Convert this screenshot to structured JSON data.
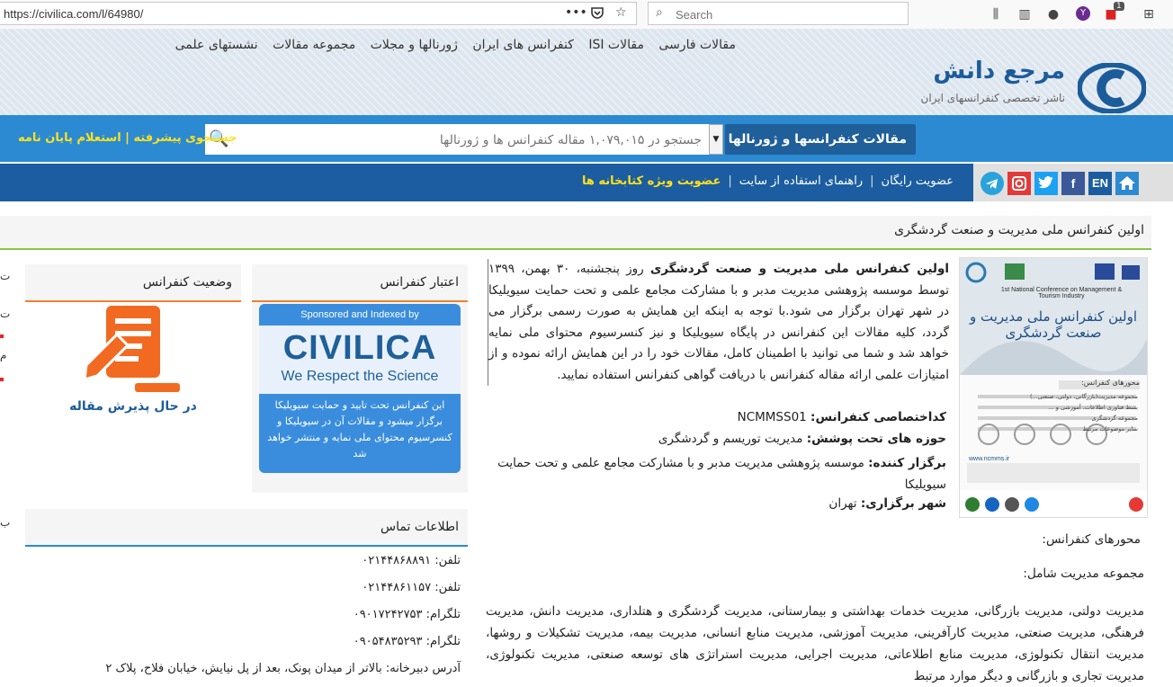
{
  "browser": {
    "url": "https://civilica.com/l/64980/",
    "search_placeholder": "Search",
    "badge_count": "1"
  },
  "header": {
    "nav": [
      "مقالات فارسی",
      "مقالات ISI",
      "کنفرانس های ایران",
      "ژورنالها و مجلات",
      "مجموعه مقالات",
      "نشستهای علمی"
    ],
    "brand_title": "مرجع دانش",
    "brand_subtitle": "ناشر تخصصی کنفرانسهای ایران"
  },
  "search": {
    "category": "مقالات کنفرانسها و ژورنالها داخلی",
    "placeholder": "جستجو در ۱,۰۷۹,۰۱۵ مقاله کنفرانس ها و ژورنالها",
    "links": "جستجوی پیشرفته | استعلام پایان نامه"
  },
  "navbar": {
    "lang": "EN",
    "links": [
      "عضویت رایگان",
      "راهنمای استفاده از سایت",
      "عضویت ویژه کتابخانه ها"
    ]
  },
  "conference": {
    "title": "اولین کنفرانس ملی مدیریت و صنعت گردشگری",
    "desc_strong": "اولین کنفرانس ملی مدیریت و صنعت گردشگری",
    "desc_rest": " روز پنجشنبه، ۳۰ بهمن، ۱۳۹۹ توسط موسسه پژوهشی مدیریت مدبر و با مشارکت مجامع علمی و تحت حمایت سیویلیکا در شهر تهران برگزار می شود.با توجه به اینکه این همایش به صورت رسمی برگزار می گردد، کلیه مقالات این کنفرانس در پایگاه سیویلیکا و نیز کنسرسیوم محتوای ملی نمایه خواهد شد و شما می توانید با اطمینان کامل، مقالات خود را در این همایش ارائه نموده و از امتیازات علمی ارائه مقاله کنفرانس با دریافت گواهی کنفرانس استفاده نمایید.",
    "code_label": "کداختصاصی کنفرانس:",
    "code": "NCMMSS01",
    "domain_label": "حوزه های تحت پوشش:",
    "domain": "مدیریت توریسم و گردشگری",
    "organizer_label": "برگزار کننده:",
    "organizer": "موسسه پژوهشی مدیریت مدبر و با مشارکت مجامع علمی و تحت حمایت سیویلیکا",
    "city_label": "شهر برگزاری:",
    "city": "تهران",
    "axes_heading": "محورهای کنفرانس:",
    "axes_group": "مجموعه مدیریت شامل:",
    "axes_text": "مدیریت دولتی، مدیریت بازرگانی، مدیریت خدمات بهداشتی و بیمارستانی، مدیریت گردشگری و هتلداری، مدیریت دانش، مدیریت فرهنگی، مدیریت صنعتی، مدیریت کارآفرینی، مدیریت آموزشی، مدیریت  منابع انسانی، مدیریت بیمه، مدیریت تشکیلات و روشها، مدیریت انتقال تکنولوژی، مدیریت منابع اطلاعاتی، مدیریت اجرایی، مدیریت استراتژی های توسعه صنعتی، مدیریت تکنولوژی، مدیریت تجاری و بازرگانی و دیگر موارد مرتبط"
  },
  "credit_box": {
    "heading": "اعتبار کنفرانس",
    "sponsor_top": "Sponsored and Indexed by",
    "sponsor_brand": "CIVILICA",
    "sponsor_tagline": "We Respect the Science",
    "sponsor_text": "این کنفرانس تحت تایید و حمایت سیویلیکا برگزار میشود و مقالات آن در سیویلیکا و کنسرسیوم محتوای ملی نمایه و منتشر خواهد شد"
  },
  "status_box": {
    "heading": "وضعیت کنفرانس",
    "status": "در حال پذیرش مقاله"
  },
  "contact_box": {
    "heading": "اطلاعات تماس",
    "lines": [
      {
        "label": "تلفن:",
        "value": "۰۲۱۴۴۸۶۸۸۹۱"
      },
      {
        "label": "تلفن:",
        "value": "۰۲۱۴۴۸۶۱۱۵۷"
      },
      {
        "label": "تلگرام:",
        "value": "۰۹۰۱۷۲۴۲۷۵۳"
      },
      {
        "label": "تلگرام:",
        "value": "۰۹۰۵۴۸۳۵۲۹۳"
      },
      {
        "label": "آدرس دبیرخانه:",
        "value": "بالاتر از میدان پونک، بعد از پل نیایش، خیابان فلاح، پلاک ۲"
      }
    ]
  },
  "poster": {
    "heading_en": "1st National Conference on Management & Tourism Industry",
    "heading_fa": "اولین کنفرانس ملی مدیریت و صنعت گردشگری",
    "axes_title": "محورهای کنفرانس:",
    "bullets": [
      "مجموعه مدیریت(بازرگانی، دولتی، صنعتی...)",
      "بسط فناوری اطلاعات، آموزشی و ...",
      "مجموعه گردشگری",
      "سایر موضوعات مرتبط"
    ],
    "site": "www.ncmms.ir"
  },
  "colors": {
    "accent_blue": "#2b8ad2",
    "dark_blue": "#1b5da0",
    "orange": "#f08030",
    "green_line": "#8cc63f",
    "yellow_link": "#ffe11e"
  },
  "icons": [
    "home-icon",
    "facebook-icon",
    "twitter-icon",
    "instagram-icon",
    "telegram-icon",
    "search-icon",
    "document-edit-icon"
  ]
}
